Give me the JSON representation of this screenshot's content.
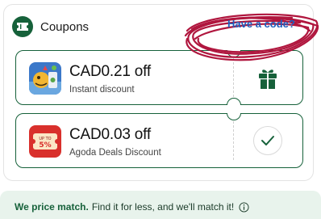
{
  "coupons_panel": {
    "title": "Coupons",
    "have_code_link": "Have a code?",
    "coupons": [
      {
        "amount": "CAD0.21 off",
        "description": "Instant discount",
        "action_icon": "gift-icon"
      },
      {
        "amount": "CAD0.03 off",
        "description": "Agoda Deals Discount",
        "action_icon": "check-icon"
      }
    ]
  },
  "price_match": {
    "bold": "We price match.",
    "text": "Find it for less, and we'll match it!",
    "icon": "info-icon"
  },
  "colors": {
    "brand_green": "#16613a",
    "link_blue": "#1f5fbf",
    "scribble_red": "#b0163e",
    "match_bg": "#e8f3ec"
  }
}
